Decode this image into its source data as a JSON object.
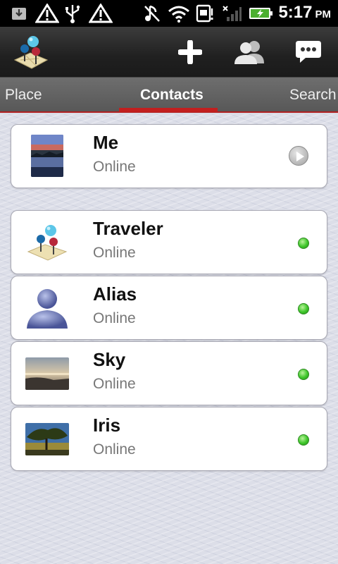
{
  "status_bar": {
    "time": "5:17",
    "ampm": "PM",
    "icons": [
      "download-icon",
      "warning-icon",
      "usb-icon",
      "warning-icon",
      "music-off-icon",
      "wifi-icon",
      "sim-icon",
      "signal-icon",
      "battery-charging-icon"
    ]
  },
  "action_bar": {
    "logo_icon": "map-pins-icon",
    "add_icon": "plus-icon",
    "contacts_icon": "people-icon",
    "chat_icon": "speech-bubble-icon"
  },
  "tabs": [
    {
      "label": "Place"
    },
    {
      "label": "Contacts",
      "active": true
    },
    {
      "label": "Search"
    }
  ],
  "me": {
    "name": "Me",
    "status": "Online"
  },
  "contacts": [
    {
      "name": "Traveler",
      "status": "Online"
    },
    {
      "name": "Alias",
      "status": "Online"
    },
    {
      "name": "Sky",
      "status": "Online"
    },
    {
      "name": "Iris",
      "status": "Online"
    }
  ],
  "colors": {
    "accent": "#c21f1f",
    "online": "#3ec62a"
  }
}
